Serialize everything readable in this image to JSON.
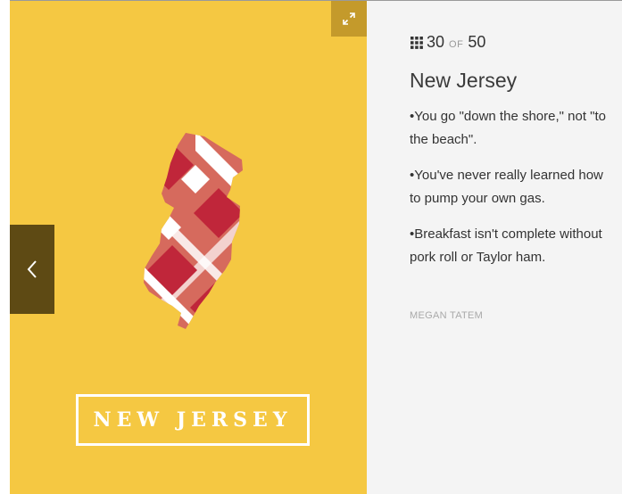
{
  "slide": {
    "title": "NEW JERSEY",
    "expand_icon": "expand-arrows-icon",
    "prev_icon": "chevron-left-icon",
    "colors": {
      "background": "#f5c842",
      "expand_button": "#c49a2b",
      "prev_button": "#5e4a14",
      "plaid_dark": "#c0263a",
      "plaid_mid": "#d66a5d",
      "plaid_light": "#ffffff"
    }
  },
  "panel": {
    "counter": {
      "icon": "grid-icon",
      "current": "30",
      "of": "OF",
      "total": "50"
    },
    "state_name": "New Jersey",
    "facts": [
      "•You go \"down the shore,\" not \"to the beach\".",
      "•You've never really learned how to pump your own gas.",
      "•Breakfast isn't complete without pork roll or Taylor ham."
    ],
    "author": "MEGAN TATEM"
  }
}
